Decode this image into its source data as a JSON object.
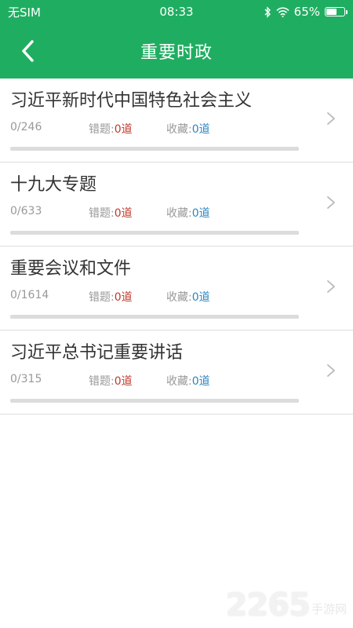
{
  "status_bar": {
    "carrier": "无SIM",
    "time": "08:33",
    "battery_text": "65%",
    "battery_level": 0.65
  },
  "nav": {
    "title": "重要时政",
    "back_icon": "chevron-left-icon"
  },
  "items": [
    {
      "title": "习近平新时代中国特色社会主义",
      "progress": "0/246",
      "wrong_label": "错题:",
      "wrong_value": "0道",
      "fav_label": "收藏:",
      "fav_value": "0道",
      "completion": 0
    },
    {
      "title": "十九大专题",
      "progress": "0/633",
      "wrong_label": "错题:",
      "wrong_value": "0道",
      "fav_label": "收藏:",
      "fav_value": "0道",
      "completion": 0
    },
    {
      "title": "重要会议和文件",
      "progress": "0/1614",
      "wrong_label": "错题:",
      "wrong_value": "0道",
      "fav_label": "收藏:",
      "fav_value": "0道",
      "completion": 0
    },
    {
      "title": "习近平总书记重要讲话",
      "progress": "0/315",
      "wrong_label": "错题:",
      "wrong_value": "0道",
      "fav_label": "收藏:",
      "fav_value": "0道",
      "completion": 0
    }
  ],
  "watermark": {
    "number": "2265",
    "text": "手游网"
  },
  "colors": {
    "primary": "#1fae61",
    "wrong": "#c0392b",
    "favorite": "#2e86c1"
  }
}
